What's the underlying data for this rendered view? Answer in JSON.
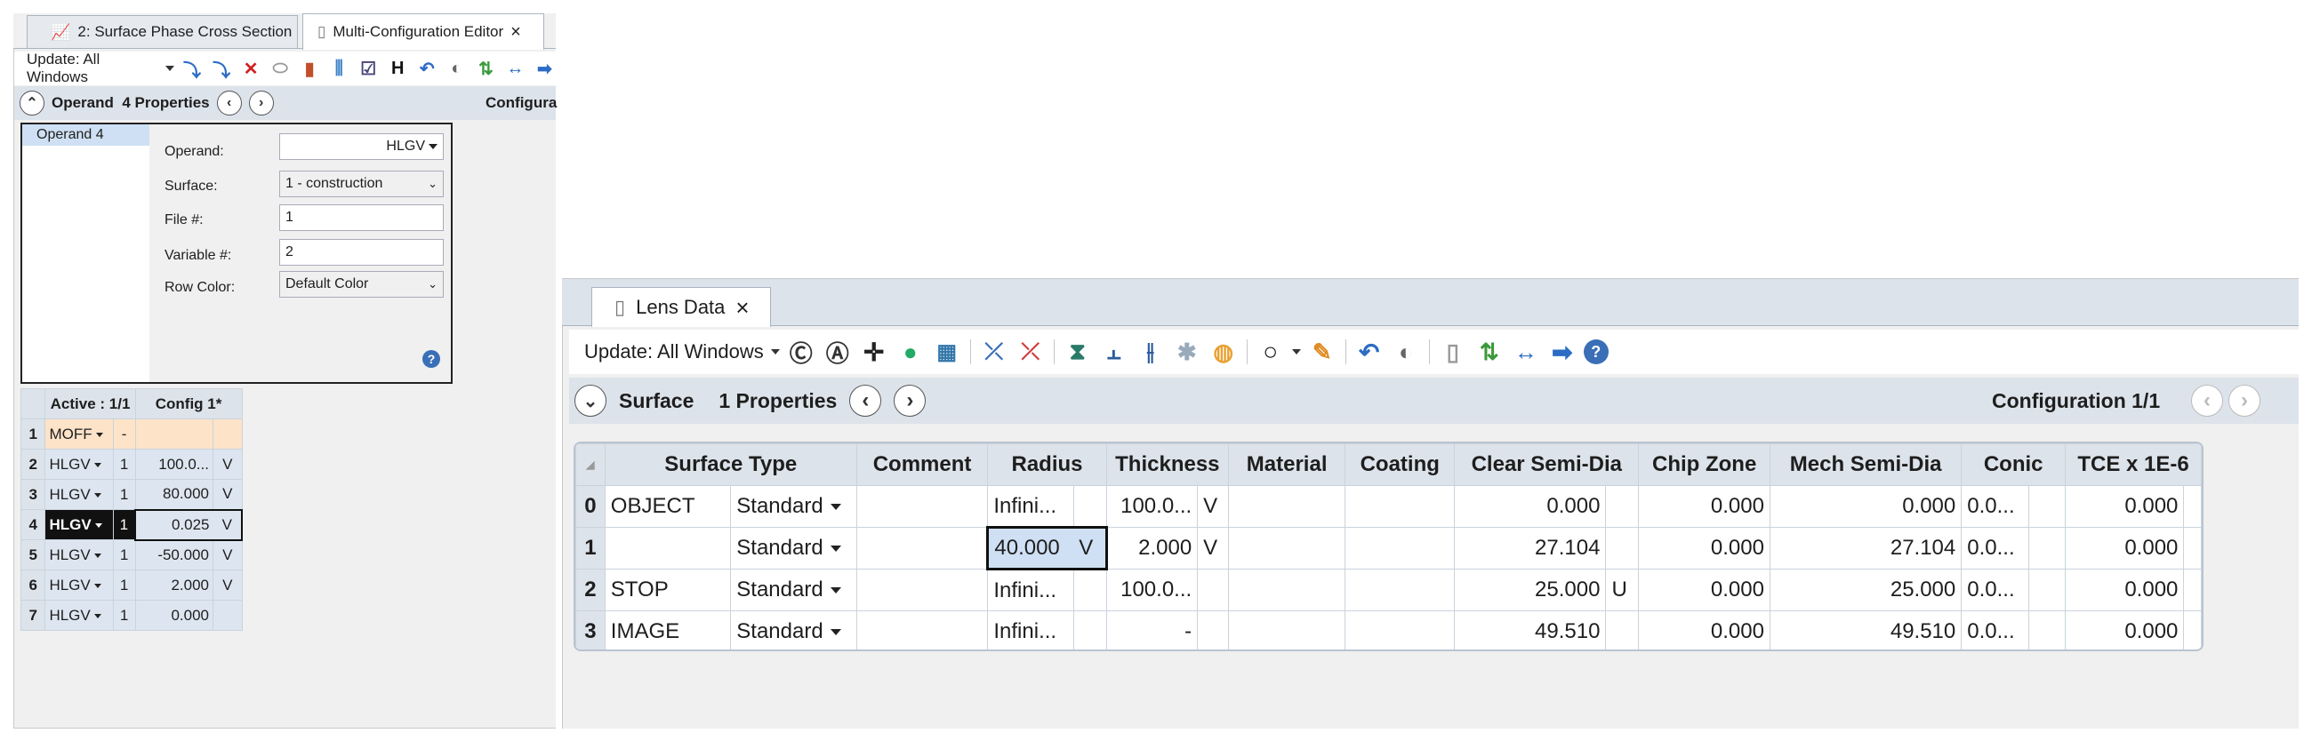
{
  "left": {
    "tabs": [
      {
        "label": "2: Surface Phase Cross Section"
      },
      {
        "label": "Multi-Configuration Editor",
        "close": "×"
      }
    ],
    "toolbar": {
      "update_label": "Update: All Windows"
    },
    "props_header": {
      "title": "Operand  4 Properties",
      "config_label": "Configura"
    },
    "props": {
      "list_item": "Operand 4",
      "operand_label": "Operand:",
      "operand_value": "HLGV",
      "surface_label": "Surface:",
      "surface_value": "1 - construction",
      "file_label": "File #:",
      "file_value": "1",
      "variable_label": "Variable #:",
      "variable_value": "2",
      "rowcolor_label": "Row Color:",
      "rowcolor_value": "Default Color",
      "help": "?"
    },
    "table": {
      "headers": {
        "active": "Active : 1/1",
        "config": "Config 1*"
      },
      "rows": [
        {
          "n": "1",
          "op": "MOFF",
          "arg": "-",
          "val": "",
          "st": ""
        },
        {
          "n": "2",
          "op": "HLGV",
          "arg": "1",
          "val": "100.0...",
          "st": "V"
        },
        {
          "n": "3",
          "op": "HLGV",
          "arg": "1",
          "val": "80.000",
          "st": "V"
        },
        {
          "n": "4",
          "op": "HLGV",
          "arg": "1",
          "val": "0.025",
          "st": "V"
        },
        {
          "n": "5",
          "op": "HLGV",
          "arg": "1",
          "val": "-50.000",
          "st": "V"
        },
        {
          "n": "6",
          "op": "HLGV",
          "arg": "1",
          "val": "2.000",
          "st": "V"
        },
        {
          "n": "7",
          "op": "HLGV",
          "arg": "1",
          "val": "0.000",
          "st": ""
        }
      ]
    }
  },
  "right": {
    "tab": {
      "label": "Lens Data",
      "close": "×"
    },
    "toolbar": {
      "update_label": "Update: All Windows"
    },
    "props_header": {
      "title": "Surface",
      "props": "1 Properties",
      "config": "Configuration 1/1"
    },
    "table": {
      "headers": [
        "Surface Type",
        "Comment",
        "Radius",
        "Thickness",
        "Material",
        "Coating",
        "Clear Semi-Dia",
        "Chip Zone",
        "Mech Semi-Dia",
        "Conic",
        "TCE x 1E-6"
      ],
      "rows": [
        {
          "n": "0",
          "name": "OBJECT",
          "type": "Standard",
          "radius": "Infini...",
          "rs": "",
          "thick": "100.0...",
          "ts": "V",
          "clear": "0.000",
          "cs": "",
          "chip": "0.000",
          "mech": "0.000",
          "conic": "0.0...",
          "tce": "0.000"
        },
        {
          "n": "1",
          "name": "",
          "type": "Standard",
          "radius": "40.000",
          "rs": "V",
          "thick": "2.000",
          "ts": "V",
          "clear": "27.104",
          "cs": "",
          "chip": "0.000",
          "mech": "27.104",
          "conic": "0.0...",
          "tce": "0.000"
        },
        {
          "n": "2",
          "name": "STOP",
          "type": "Standard",
          "radius": "Infini...",
          "rs": "",
          "thick": "100.0...",
          "ts": "",
          "clear": "25.000",
          "cs": "U",
          "chip": "0.000",
          "mech": "25.000",
          "conic": "0.0...",
          "tce": "0.000"
        },
        {
          "n": "3",
          "name": "IMAGE",
          "type": "Standard",
          "radius": "Infini...",
          "rs": "",
          "thick": "-",
          "ts": "",
          "clear": "49.510",
          "cs": "",
          "chip": "0.000",
          "mech": "49.510",
          "conic": "0.0...",
          "tce": "0.000"
        }
      ]
    }
  }
}
